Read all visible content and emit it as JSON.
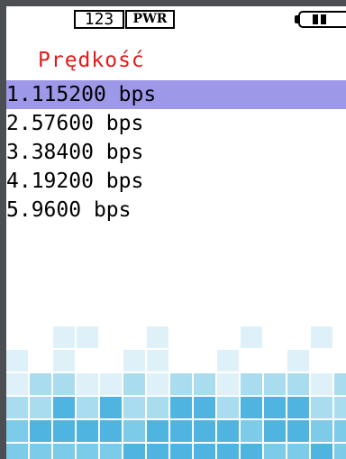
{
  "status": {
    "mode_label": "123",
    "power_label": "PWR",
    "battery_icon": "battery-icon",
    "battery_level": 0.5
  },
  "title": "Prędkość",
  "menu": {
    "selected_index": 0,
    "items": [
      {
        "number": "1.",
        "label": "115200 bps"
      },
      {
        "number": "2.",
        "label": "57600 bps"
      },
      {
        "number": "3.",
        "label": "38400 bps"
      },
      {
        "number": "4.",
        "label": "19200 bps"
      },
      {
        "number": "5.",
        "label": "9600 bps"
      }
    ]
  },
  "colors": {
    "title": "#e31a1a",
    "selection": "#9d98e8",
    "bezel": "#4b4e53",
    "mosaic_light": "#dff1f8",
    "mosaic_mid": "#a9dcef",
    "mosaic_dark": "#4fb4e0"
  }
}
